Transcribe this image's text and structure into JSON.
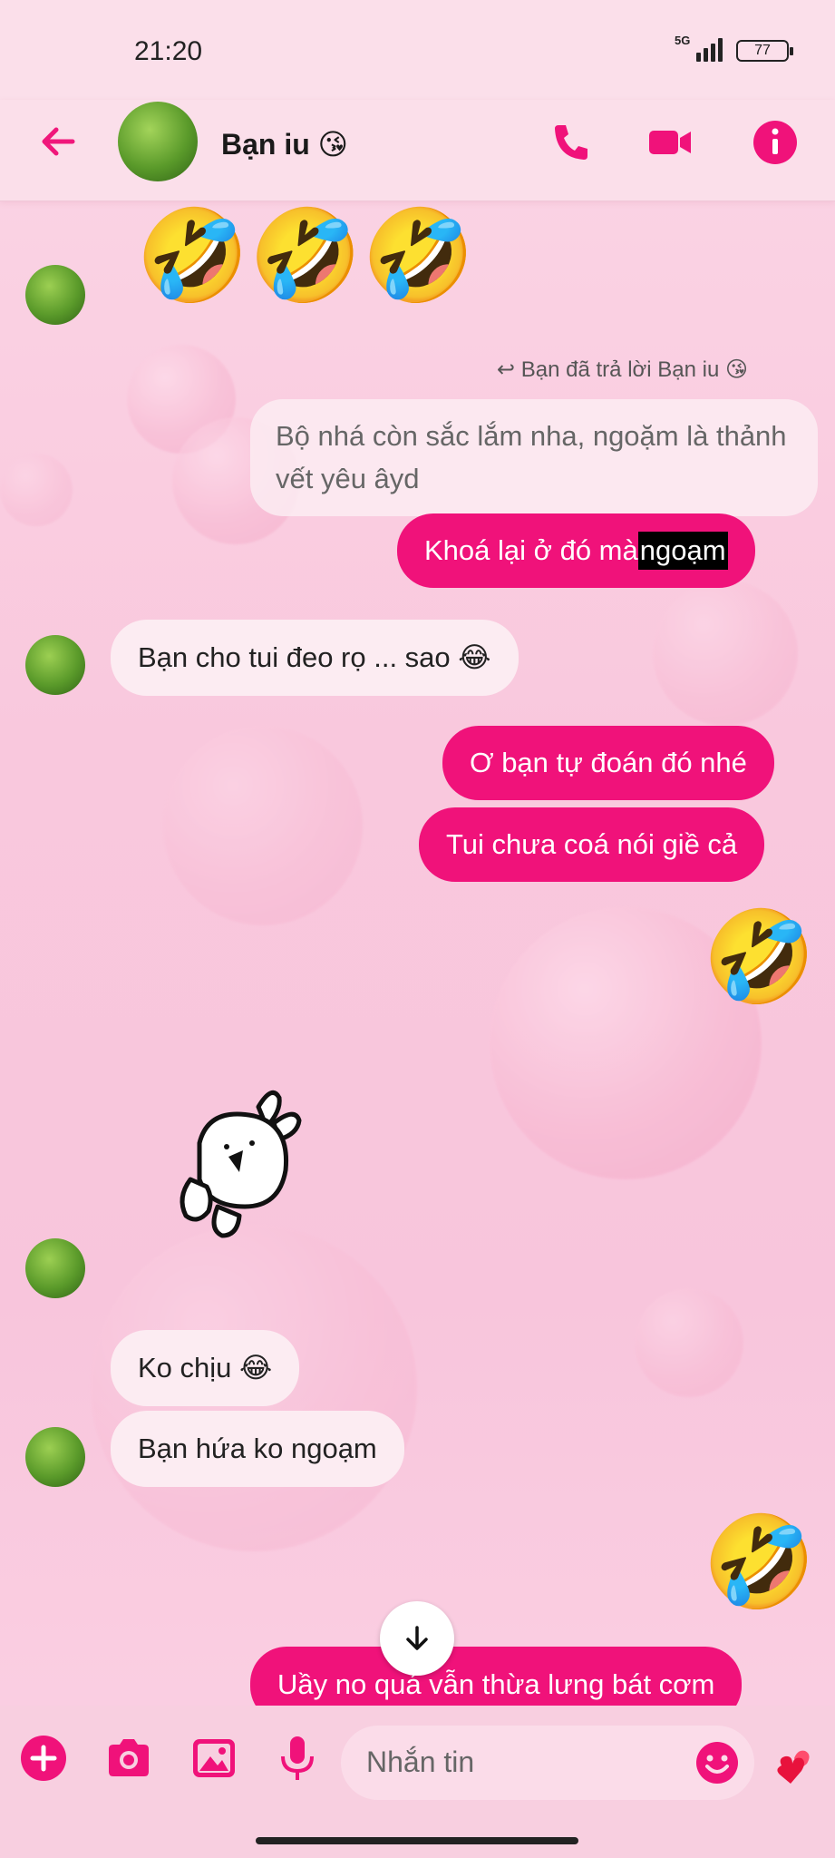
{
  "status": {
    "time": "21:20",
    "network": "5G",
    "battery": "77"
  },
  "header": {
    "contact_name": "Bạn iu 😘"
  },
  "messages": {
    "top_emojis": "🤣🤣🤣",
    "reply_label": "Bạn đã trả lời Bạn iu 😘",
    "reply_quote": "Bộ nhá còn sắc lắm nha, ngoặm là thảnh vết yêu âyd",
    "reply_main": "Khoá lại ở đó mà ",
    "reply_highlight": "ngoạm",
    "in_1": "Bạn cho tui đeo rọ ... sao 😂",
    "out_1": "Ơ bạn tự đoán đó nhé",
    "out_2": "Tui chưa coá nói giề cả",
    "emoji_1": "🤣",
    "in_2": "Ko chịu 😂",
    "in_3": "Bạn hứa ko ngoạm",
    "emoji_2": "🤣",
    "out_3": "Uầy no quá vẫn thừa lưng bát cơm"
  },
  "composer": {
    "placeholder": "Nhắn tin"
  },
  "colors": {
    "accent": "#f0127a",
    "incoming_bubble": "#fcecf2",
    "background": "#f9c8dd"
  },
  "icons": [
    "back-arrow-icon",
    "phone-icon",
    "video-icon",
    "info-icon",
    "plus-icon",
    "camera-icon",
    "image-icon",
    "microphone-icon",
    "smiley-icon",
    "hearts-icon",
    "chevron-down-icon"
  ]
}
